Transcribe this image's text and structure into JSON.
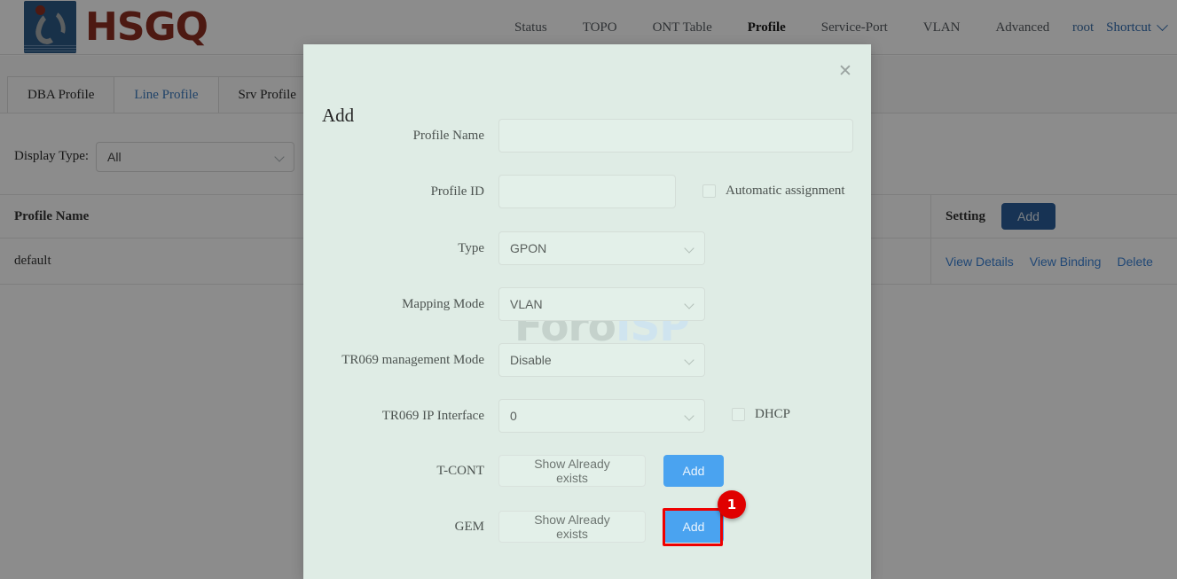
{
  "brand": {
    "name": "HSGQ"
  },
  "nav": {
    "items": [
      {
        "label": "Status",
        "active": false
      },
      {
        "label": "TOPO",
        "active": false
      },
      {
        "label": "ONT Table",
        "active": false
      },
      {
        "label": "Profile",
        "active": true
      },
      {
        "label": "Service-Port",
        "active": false
      },
      {
        "label": "VLAN",
        "active": false
      },
      {
        "label": "Advanced",
        "active": false
      }
    ],
    "user": "root",
    "shortcut": "Shortcut"
  },
  "tabs": [
    {
      "label": "DBA Profile",
      "active": false
    },
    {
      "label": "Line Profile",
      "active": true
    },
    {
      "label": "Srv Profile",
      "active": false
    }
  ],
  "filter": {
    "label": "Display Type:",
    "value": "All"
  },
  "table": {
    "headers": {
      "name": "Profile Name",
      "setting": "Setting"
    },
    "add_button": "Add",
    "rows": [
      {
        "name": "default",
        "actions": [
          "View Details",
          "View Binding",
          "Delete"
        ]
      }
    ]
  },
  "modal": {
    "title": "Add",
    "close_icon": "close-icon",
    "fields": {
      "profile_name": {
        "label": "Profile Name",
        "value": "",
        "placeholder": ""
      },
      "profile_id": {
        "label": "Profile ID",
        "value": "",
        "placeholder": ""
      },
      "automatic_assignment": {
        "label": "Automatic assignment",
        "checked": false
      },
      "type": {
        "label": "Type",
        "value": "GPON"
      },
      "mapping_mode": {
        "label": "Mapping Mode",
        "value": "VLAN"
      },
      "tr069_management_mode": {
        "label": "TR069 management Mode",
        "value": "Disable"
      },
      "tr069_ip_interface": {
        "label": "TR069 IP Interface",
        "value": "0"
      },
      "dhcp": {
        "label": "DHCP",
        "checked": false
      },
      "tcont": {
        "label": "T-CONT",
        "show_button": "Show Already exists",
        "add_button": "Add"
      },
      "gem": {
        "label": "GEM",
        "show_button": "Show Already exists",
        "add_button": "Add"
      }
    }
  },
  "watermark": {
    "part1": "Foro",
    "part2": "ISP"
  },
  "annotation": {
    "step": "1"
  },
  "colors": {
    "brand_red": "#8c2f22",
    "brand_blue": "#2d5986",
    "link_blue": "#3b82d6",
    "primary_button": "#4aa3f0",
    "table_button": "#2b5e99",
    "modal_bg": "#dfece5",
    "annotation_red": "#ee0000"
  }
}
